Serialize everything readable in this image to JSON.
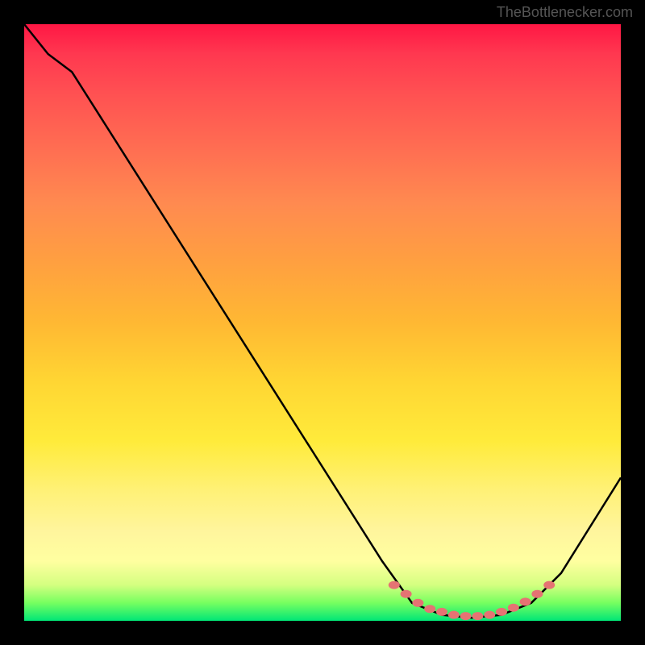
{
  "attribution": "TheBottlenecker.com",
  "chart_data": {
    "type": "line",
    "title": "",
    "xlabel": "",
    "ylabel": "",
    "xlim": [
      0,
      100
    ],
    "ylim": [
      0,
      100
    ],
    "curve_points": [
      {
        "x": 0,
        "y": 100
      },
      {
        "x": 4,
        "y": 95
      },
      {
        "x": 8,
        "y": 92
      },
      {
        "x": 60,
        "y": 10
      },
      {
        "x": 65,
        "y": 3
      },
      {
        "x": 70,
        "y": 1
      },
      {
        "x": 75,
        "y": 0.5
      },
      {
        "x": 80,
        "y": 1
      },
      {
        "x": 85,
        "y": 3
      },
      {
        "x": 90,
        "y": 8
      },
      {
        "x": 100,
        "y": 24
      }
    ],
    "markers": [
      {
        "x": 62,
        "y": 6
      },
      {
        "x": 64,
        "y": 4.5
      },
      {
        "x": 66,
        "y": 3
      },
      {
        "x": 68,
        "y": 2
      },
      {
        "x": 70,
        "y": 1.5
      },
      {
        "x": 72,
        "y": 1
      },
      {
        "x": 74,
        "y": 0.8
      },
      {
        "x": 76,
        "y": 0.8
      },
      {
        "x": 78,
        "y": 1
      },
      {
        "x": 80,
        "y": 1.5
      },
      {
        "x": 82,
        "y": 2.2
      },
      {
        "x": 84,
        "y": 3.2
      },
      {
        "x": 86,
        "y": 4.5
      },
      {
        "x": 88,
        "y": 6
      }
    ],
    "marker_color": "#e57373",
    "line_color": "#000000"
  }
}
